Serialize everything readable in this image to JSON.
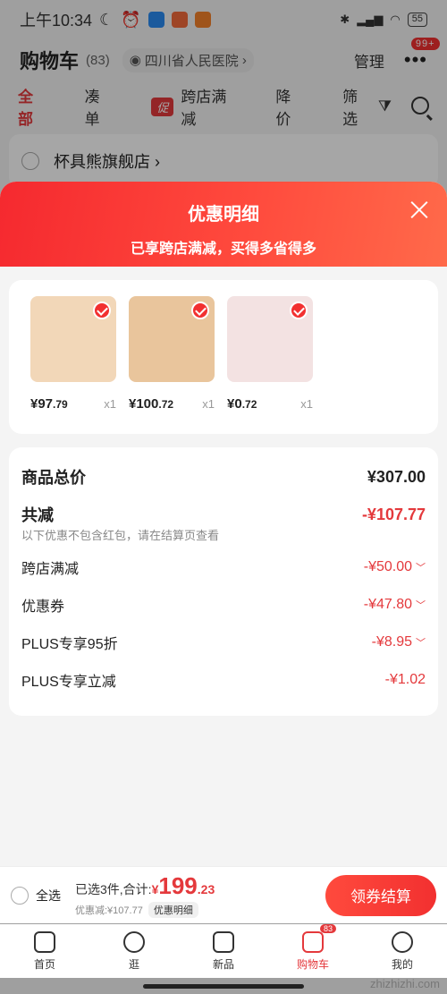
{
  "status_bar": {
    "time": "上午10:34",
    "battery": "55"
  },
  "header": {
    "title": "购物车",
    "count": "(83)",
    "location": "四川省人民医院",
    "manage": "管理",
    "more_badge": "99+"
  },
  "tabs": [
    {
      "label": "全部"
    },
    {
      "label": "凑单"
    },
    {
      "tag": "促",
      "label": "跨店满减"
    },
    {
      "label": "降价"
    },
    {
      "label": "筛选"
    }
  ],
  "shop": {
    "name": "杯具熊旗舰店 ›"
  },
  "sheet": {
    "title": "优惠明细",
    "subtitle": "已享跨店满减，买得多省得多",
    "products": [
      {
        "price_int": "¥97",
        "price_cents": ".79",
        "qty": "x1",
        "color": "#f2d7b8"
      },
      {
        "price_int": "¥100",
        "price_cents": ".72",
        "qty": "x1",
        "color": "#e9c59c"
      },
      {
        "price_int": "¥0",
        "price_cents": ".72",
        "qty": "x1",
        "color": "#f3e2e2"
      }
    ],
    "total_label": "商品总价",
    "total_value": "¥307.00",
    "reduce_label": "共减",
    "reduce_value": "-¥107.77",
    "reduce_note": "以下优惠不包含红包，请在结算页查看",
    "items": [
      {
        "label": "跨店满减",
        "value": "-¥50.00",
        "chevron": "﹀"
      },
      {
        "label": "优惠券",
        "value": "-¥47.80",
        "chevron": "﹀"
      },
      {
        "label": "PLUS专享95折",
        "value": "-¥8.95",
        "chevron": "﹀"
      },
      {
        "label": "PLUS专享立减",
        "value": "-¥1.02",
        "chevron": ""
      }
    ]
  },
  "checkout": {
    "select_all": "全选",
    "summary_prefix": "已选3件,合计:",
    "currency": "¥",
    "amount_int": "199",
    "amount_cents": ".23",
    "discount": "优惠减:¥107.77",
    "detail_chip": "优惠明细",
    "button": "领券结算"
  },
  "nav": [
    {
      "label": "首页"
    },
    {
      "label": "逛"
    },
    {
      "label": "新品"
    },
    {
      "label": "购物车",
      "badge": "83"
    },
    {
      "label": "我的"
    }
  ],
  "watermark": "zhizhizhi.com"
}
